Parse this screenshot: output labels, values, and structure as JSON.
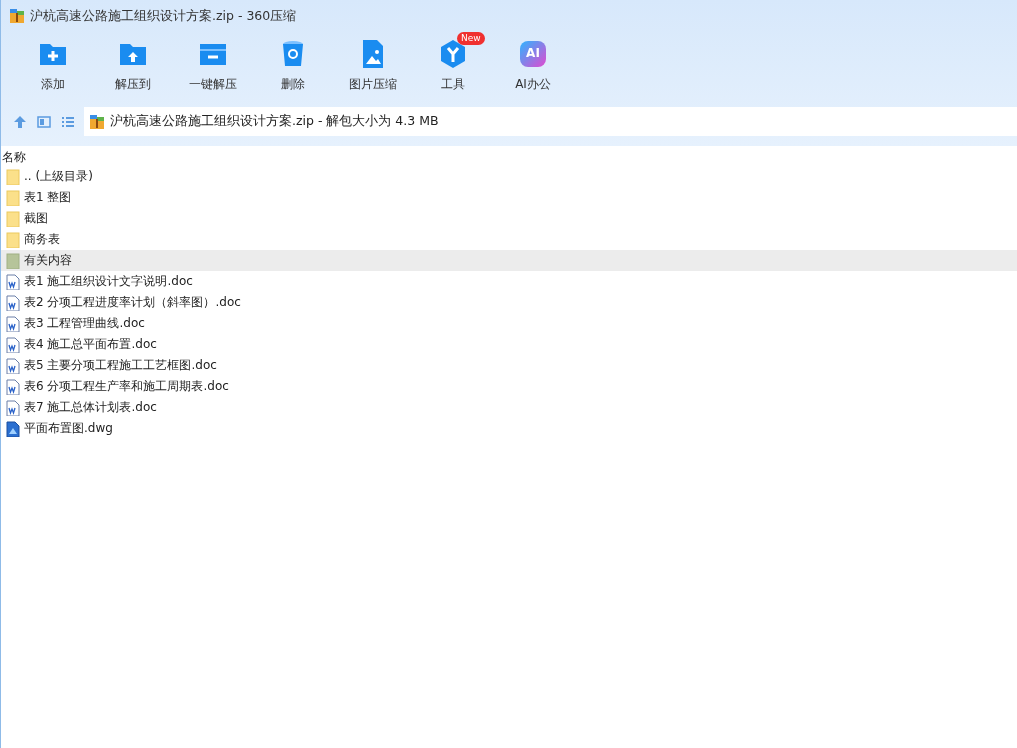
{
  "window": {
    "title": "沪杭高速公路施工组织设计方案.zip - 360压缩"
  },
  "toolbar": [
    {
      "kind": "add",
      "label": "添加"
    },
    {
      "kind": "extract",
      "label": "解压到"
    },
    {
      "kind": "oneclick",
      "label": "一键解压"
    },
    {
      "kind": "delete",
      "label": "删除"
    },
    {
      "kind": "image",
      "label": "图片压缩"
    },
    {
      "kind": "tools",
      "label": "工具",
      "badge": "New"
    },
    {
      "kind": "ai",
      "label": "AI办公",
      "logo": "AI"
    }
  ],
  "address": {
    "path": "沪杭高速公路施工组织设计方案.zip - 解包大小为 4.3 MB"
  },
  "table": {
    "columns": [
      "名称"
    ],
    "rows": [
      {
        "kind": "folder",
        "name": ".. (上级目录)",
        "selected": false
      },
      {
        "kind": "folder",
        "name": "表1 整图",
        "selected": false
      },
      {
        "kind": "folder",
        "name": "截图",
        "selected": false
      },
      {
        "kind": "folder",
        "name": "商务表",
        "selected": false
      },
      {
        "kind": "folder",
        "name": "有关内容",
        "selected": true
      },
      {
        "kind": "doc",
        "name": "表1  施工组织设计文字说明.doc",
        "selected": false
      },
      {
        "kind": "doc",
        "name": "表2 分项工程进度率计划（斜率图）.doc",
        "selected": false
      },
      {
        "kind": "doc",
        "name": "表3  工程管理曲线.doc",
        "selected": false
      },
      {
        "kind": "doc",
        "name": "表4 施工总平面布置.doc",
        "selected": false
      },
      {
        "kind": "doc",
        "name": "表5 主要分项工程施工工艺框图.doc",
        "selected": false
      },
      {
        "kind": "doc",
        "name": "表6  分项工程生产率和施工周期表.doc",
        "selected": false
      },
      {
        "kind": "doc",
        "name": "表7  施工总体计划表.doc",
        "selected": false
      },
      {
        "kind": "dwg",
        "name": "平面布置图.dwg",
        "selected": false
      }
    ]
  }
}
